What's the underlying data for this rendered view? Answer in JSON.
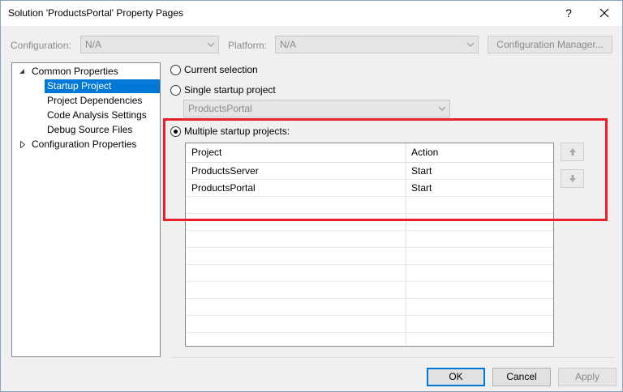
{
  "window": {
    "title": "Solution 'ProductsPortal' Property Pages",
    "help_label": "?"
  },
  "toolbar": {
    "configuration_label": "Configuration:",
    "configuration_value": "N/A",
    "platform_label": "Platform:",
    "platform_value": "N/A",
    "config_manager_label": "Configuration Manager..."
  },
  "tree": {
    "items": [
      {
        "label": "Common Properties"
      },
      {
        "label": "Startup Project"
      },
      {
        "label": "Project Dependencies"
      },
      {
        "label": "Code Analysis Settings"
      },
      {
        "label": "Debug Source Files"
      },
      {
        "label": "Configuration Properties"
      }
    ]
  },
  "startup": {
    "current_selection_label": "Current selection",
    "single_label": "Single startup project",
    "single_value": "ProductsPortal",
    "multiple_label": "Multiple startup projects:",
    "selected_option": "multiple"
  },
  "grid": {
    "columns": [
      "Project",
      "Action"
    ],
    "rows": [
      {
        "project": "ProductsServer",
        "action": "Start"
      },
      {
        "project": "ProductsPortal",
        "action": "Start"
      }
    ]
  },
  "footer": {
    "ok_label": "OK",
    "cancel_label": "Cancel",
    "apply_label": "Apply"
  },
  "colors": {
    "selection": "#0078d7",
    "highlight_box": "#e8202a"
  },
  "icons": {
    "move_up": "arrow-up-icon",
    "move_down": "arrow-down-icon",
    "close": "close-icon"
  }
}
